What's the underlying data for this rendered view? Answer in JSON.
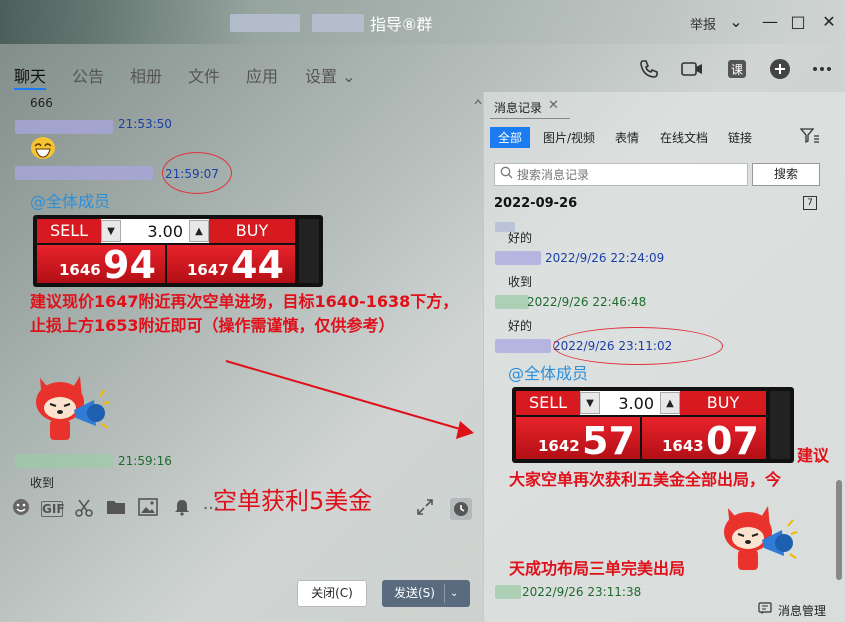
{
  "window": {
    "title": "指导⑧群",
    "report_label": "举报",
    "controls": {
      "dropdown": "⌄",
      "minimize": "—",
      "maximize": "□",
      "close": "✕"
    }
  },
  "tabs": [
    {
      "label": "聊天",
      "active": true
    },
    {
      "label": "公告"
    },
    {
      "label": "相册"
    },
    {
      "label": "文件"
    },
    {
      "label": "应用"
    },
    {
      "label": "设置 ⌄"
    }
  ],
  "chat": {
    "first_msg": "666",
    "ts1": "21:53:50",
    "ts2": "21:59:07",
    "mention": "@全体成员",
    "trade": {
      "sell": "SELL",
      "buy": "BUY",
      "qty": "3.00",
      "sell_small": "1646",
      "sell_big": "94",
      "buy_small": "1647",
      "buy_big": "44"
    },
    "advice": "建议现价1647附近再次空单进场，目标1640-1638下方，止损上方1653附近即可（操作需谨慎，仅供参考）",
    "ts3": "21:59:16",
    "last_msg": "收到",
    "profit_note": "空单获利5美金"
  },
  "buttons": {
    "close": "关闭(C)",
    "send": "发送(S)"
  },
  "history": {
    "tab_label": "消息记录",
    "filters": [
      "全部",
      "图片/视频",
      "表情",
      "在线文档",
      "链接"
    ],
    "search_placeholder": "搜索消息记录",
    "search_button": "搜索",
    "date": "2022-09-26",
    "items": [
      {
        "text": "好的",
        "time": "2022/9/26 22:24:09"
      },
      {
        "text": "收到",
        "time": "2022/9/26 22:46:48"
      },
      {
        "text": "好的",
        "time": "2022/9/26 23:11:02"
      }
    ],
    "mention": "@全体成员",
    "trade": {
      "sell": "SELL",
      "buy": "BUY",
      "qty": "3.00",
      "sell_small": "1642",
      "sell_big": "57",
      "buy_small": "1643",
      "buy_big": "07"
    },
    "note_side": "建议",
    "note_line": "大家空单再次获利五美金全部出局，今",
    "note_bottom": "天成功布局三单完美出局",
    "last_time": "2022/9/26 23:11:38",
    "manage_label": "消息管理"
  },
  "colors": {
    "accent": "#1a7cf0",
    "alert_red": "#e0101a",
    "timestamp_blue": "#1c3ea8",
    "mention_blue": "#2e8fd8"
  }
}
